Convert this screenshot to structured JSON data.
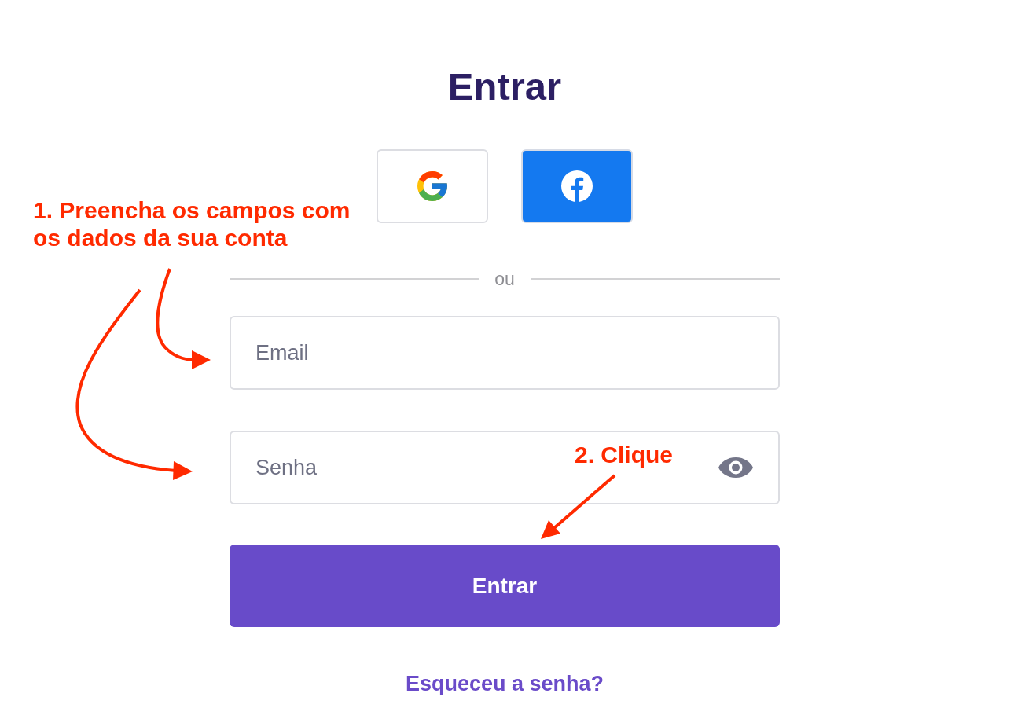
{
  "title": "Entrar",
  "social_buttons": [
    {
      "kind": "google"
    },
    {
      "kind": "facebook"
    }
  ],
  "divider": {
    "label": "ou"
  },
  "fields": [
    {
      "kind": "email",
      "placeholder": "Email"
    },
    {
      "kind": "password",
      "placeholder": "Senha"
    }
  ],
  "submit_button": {
    "label": "Entrar"
  },
  "forgot_link": {
    "label": "Esqueceu a senha?"
  },
  "annotations": [
    {
      "text": "1. Preencha os campos com os dados da sua conta"
    },
    {
      "text": "2. Clique"
    }
  ]
}
